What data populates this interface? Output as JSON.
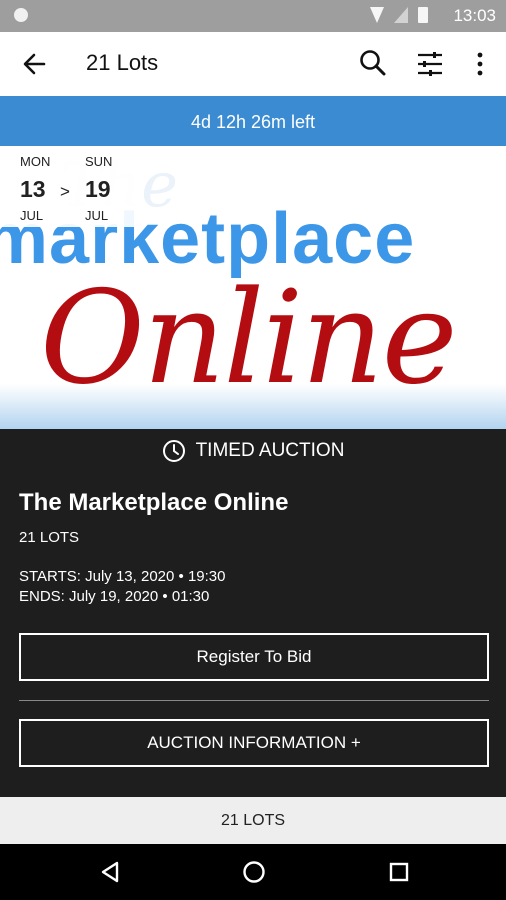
{
  "status_bar": {
    "time": "13:03"
  },
  "app_bar": {
    "title": "21 Lots"
  },
  "countdown": {
    "text": "4d 12h 26m left"
  },
  "dates": {
    "start": {
      "dow": "MON",
      "day": "13",
      "month": "JUL"
    },
    "separator": ">",
    "end": {
      "dow": "SUN",
      "day": "19",
      "month": "JUL"
    }
  },
  "hero": {
    "line1": "marketplace",
    "line2": "Online",
    "faded": "The"
  },
  "auction": {
    "type": "TIMED AUCTION",
    "name": "The Marketplace Online",
    "lots": "21 LOTS",
    "starts": "STARTS: July 13, 2020 • 19:30",
    "ends": "ENDS: July 19, 2020 • 01:30",
    "register_label": "Register To Bid",
    "info_label": "AUCTION INFORMATION +"
  },
  "footer": {
    "lots": "21 LOTS"
  },
  "colors": {
    "accent_blue": "#3a8bd2",
    "brand_red": "#b30d12",
    "panel_dark": "#1e1e1e"
  }
}
